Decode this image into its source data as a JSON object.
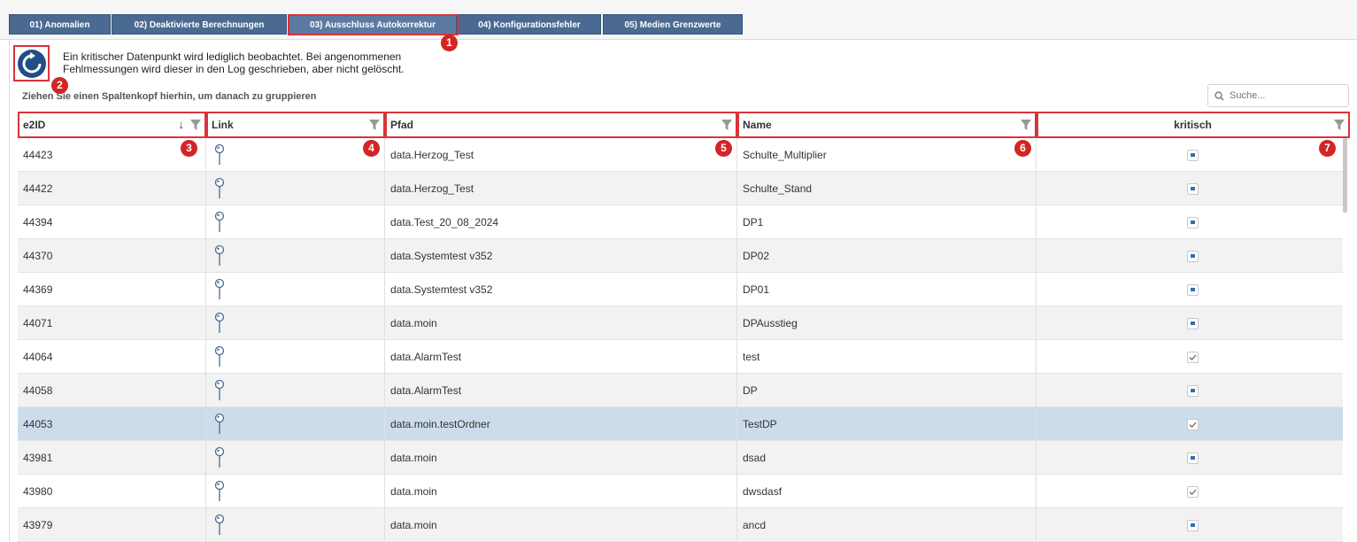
{
  "tabs": [
    {
      "label": "01) Anomalien"
    },
    {
      "label": "02) Deaktivierte Berechnungen"
    },
    {
      "label": "03) Ausschluss Autokorrektur"
    },
    {
      "label": "04) Konfigurationsfehler"
    },
    {
      "label": "05) Medien Grenzwerte"
    }
  ],
  "info": {
    "line1": "Ein kritischer Datenpunkt wird lediglich beobachtet. Bei angenommenen",
    "line2": "Fehlmessungen wird dieser in den Log geschrieben, aber nicht gelöscht."
  },
  "group_hint": "Ziehen Sie einen Spaltenkopf hierhin, um danach zu gruppieren",
  "search": {
    "placeholder": "Suche..."
  },
  "markers": [
    "1",
    "2",
    "3",
    "4",
    "5",
    "6",
    "7"
  ],
  "columns": {
    "e2id": "e2ID",
    "link": "Link",
    "pfad": "Pfad",
    "name": "Name",
    "kritisch": "kritisch"
  },
  "sort_indicator": "↓",
  "rows": [
    {
      "id": "44423",
      "pfad": "data.Herzog_Test",
      "name": "Schulte_Multiplier",
      "kritisch": "square"
    },
    {
      "id": "44422",
      "pfad": "data.Herzog_Test",
      "name": "Schulte_Stand",
      "kritisch": "square"
    },
    {
      "id": "44394",
      "pfad": "data.Test_20_08_2024",
      "name": "DP1",
      "kritisch": "square"
    },
    {
      "id": "44370",
      "pfad": "data.Systemtest v352",
      "name": "DP02",
      "kritisch": "square"
    },
    {
      "id": "44369",
      "pfad": "data.Systemtest v352",
      "name": "DP01",
      "kritisch": "square"
    },
    {
      "id": "44071",
      "pfad": "data.moin",
      "name": "DPAusstieg",
      "kritisch": "square"
    },
    {
      "id": "44064",
      "pfad": "data.AlarmTest",
      "name": "test",
      "kritisch": "check"
    },
    {
      "id": "44058",
      "pfad": "data.AlarmTest",
      "name": "DP",
      "kritisch": "square"
    },
    {
      "id": "44053",
      "pfad": "data.moin.testOrdner",
      "name": "TestDP",
      "kritisch": "check"
    },
    {
      "id": "43981",
      "pfad": "data.moin",
      "name": "dsad",
      "kritisch": "square"
    },
    {
      "id": "43980",
      "pfad": "data.moin",
      "name": "dwsdasf",
      "kritisch": "check"
    },
    {
      "id": "43979",
      "pfad": "data.moin",
      "name": "ancd",
      "kritisch": "square"
    }
  ],
  "colors": {
    "tab_bg": "#4a6a91",
    "marker": "#d22525",
    "selected_row": "#cddcea",
    "check_blue": "#2f6fb5"
  },
  "icons": {
    "refresh": "refresh-icon",
    "filter": "filter-icon",
    "link": "pin-icon",
    "search": "search-icon"
  }
}
